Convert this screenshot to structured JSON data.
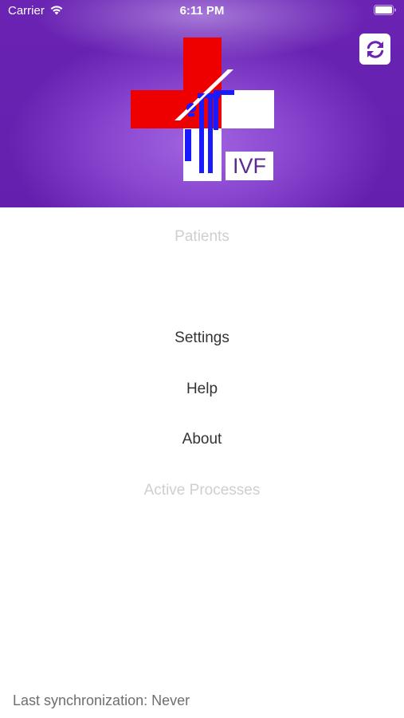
{
  "status_bar": {
    "carrier": "Carrier",
    "time": "6:11 PM",
    "wifi_icon": "wifi-icon",
    "battery_icon": "battery-icon"
  },
  "header": {
    "logo_text": "IVF",
    "sync_icon": "refresh-icon",
    "colors": {
      "purple": "#6a23b3",
      "logo_red": "#ee0000",
      "logo_blue": "#1a1aff"
    }
  },
  "menu": {
    "patients": "Patients",
    "settings": "Settings",
    "help": "Help",
    "about": "About",
    "active_processes": "Active Processes"
  },
  "footer": {
    "last_sync": "Last synchronization: Never"
  }
}
